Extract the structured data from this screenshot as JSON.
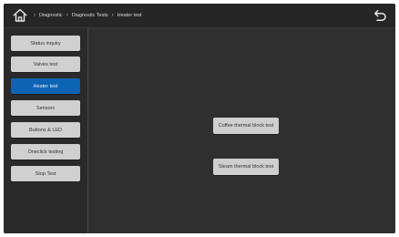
{
  "breadcrumb": {
    "items": [
      "Diagnostic",
      "Diagnostic Tests",
      "Heater test"
    ]
  },
  "icons": {
    "home": "home-icon",
    "back": "back-arrow-icon",
    "separator": "chevron-right-icon"
  },
  "sidebar": {
    "items": [
      {
        "label": "Status inquiry",
        "active": false
      },
      {
        "label": "Valves test",
        "active": false
      },
      {
        "label": "Heater test",
        "active": true
      },
      {
        "label": "Sensors",
        "active": false
      },
      {
        "label": "Buttons & LED",
        "active": false
      },
      {
        "label": "Oneclick testing",
        "active": false
      },
      {
        "label": "Stop Test",
        "active": false
      }
    ]
  },
  "main": {
    "buttons": [
      {
        "label": "Coffee thermal block test"
      },
      {
        "label": "Steam thermal block test"
      }
    ]
  },
  "colors": {
    "screen_bg": "#2e2e2e",
    "button_bg": "#d0d0d0",
    "active_bg": "#0d63b4",
    "text_light": "#d8d8d8"
  }
}
